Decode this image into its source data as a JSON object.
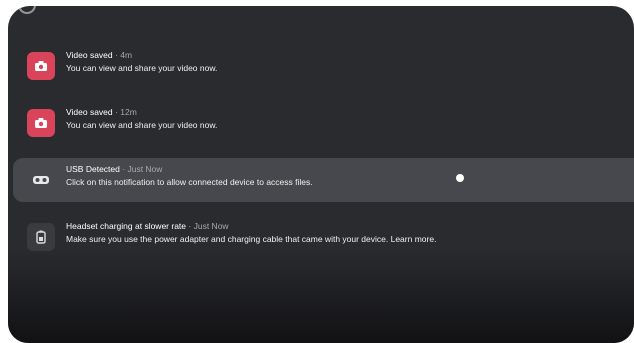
{
  "notifications": [
    {
      "icon": "camera-icon",
      "title": "Video saved",
      "separator": "·",
      "time": "4m",
      "body": "You can view and share your video now."
    },
    {
      "icon": "camera-icon",
      "title": "Video saved",
      "separator": "·",
      "time": "12m",
      "body": "You can view and share your video now."
    },
    {
      "icon": "headset-icon",
      "title": "USB Detected",
      "separator": "·",
      "time": "Just Now",
      "body": "Click on this notification to allow connected device to access files."
    },
    {
      "icon": "battery-icon",
      "title": "Headset charging at slower rate",
      "separator": "·",
      "time": "Just Now",
      "body": "Make sure you use the power adapter and charging cable that came with your device. Learn more."
    }
  ],
  "colors": {
    "panel": "#2a2b2f",
    "highlight": "#46484d",
    "accent_red": "#d9445b"
  }
}
